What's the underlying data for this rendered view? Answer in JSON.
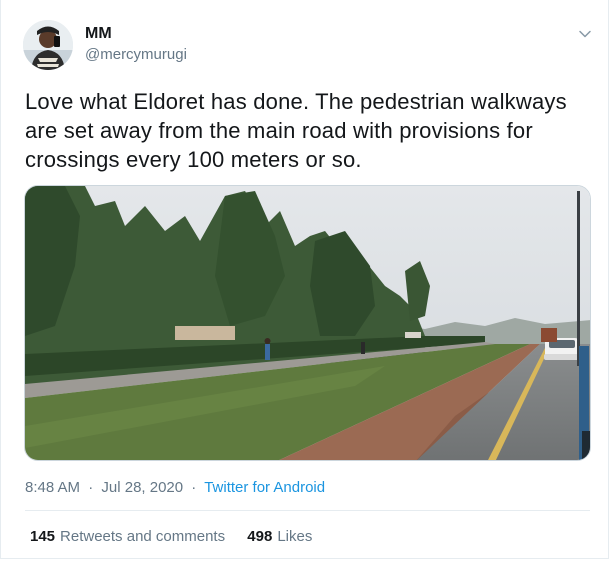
{
  "user": {
    "display_name": "MM",
    "handle": "@mercymurugi"
  },
  "tweet": {
    "text": "Love what Eldoret has done. The pedestrian walkways are set away from the main road with provisions for crossings every 100 meters or so.",
    "time": "8:48 AM",
    "date": "Jul 28, 2020",
    "separator": "·",
    "source": "Twitter for Android"
  },
  "stats": {
    "retweets_count": "145",
    "retweets_label": "Retweets and comments",
    "likes_count": "498",
    "likes_label": "Likes"
  },
  "icons": {
    "menu": "chevron-down-icon"
  },
  "colors": {
    "link": "#1b95e0",
    "secondary_text": "#657786",
    "primary_text": "#14171a",
    "border": "#e6ecf0"
  }
}
